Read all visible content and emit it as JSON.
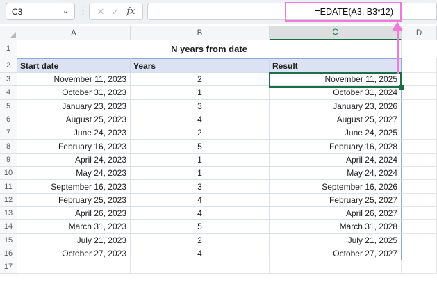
{
  "formula_bar": {
    "name_box_value": "C3",
    "formula": "=EDATE(A3, B3*12)",
    "icons": {
      "chevron_down": "⌄",
      "more_dots": "⋮",
      "cancel": "✕",
      "enter": "✓",
      "insert_function": "fx"
    }
  },
  "colors": {
    "selection_green": "#1a7043",
    "annotation_pink": "#f07ad9",
    "table_header_fill": "#dbe2f3",
    "table_border_blue": "#8ea9db"
  },
  "sheet": {
    "selected_cell": "C3",
    "columns": [
      {
        "letter": "A"
      },
      {
        "letter": "B"
      },
      {
        "letter": "C"
      },
      {
        "letter": "D"
      }
    ],
    "title_row": {
      "n": "1",
      "title": "N years from date"
    },
    "header_row": {
      "n": "2",
      "start": "Start date",
      "years": "Years",
      "result": "Result"
    },
    "rows": [
      {
        "n": "3",
        "start": "November 11, 2023",
        "years": "2",
        "result": "November 11, 2025"
      },
      {
        "n": "4",
        "start": "October 31, 2023",
        "years": "1",
        "result": "October 31, 2024"
      },
      {
        "n": "5",
        "start": "January 23, 2023",
        "years": "3",
        "result": "January 23, 2026"
      },
      {
        "n": "6",
        "start": "August 25, 2023",
        "years": "4",
        "result": "August 25, 2027"
      },
      {
        "n": "7",
        "start": "June 24, 2023",
        "years": "2",
        "result": "June 24, 2025"
      },
      {
        "n": "8",
        "start": "February 16, 2023",
        "years": "5",
        "result": "February 16, 2028"
      },
      {
        "n": "9",
        "start": "April 24, 2023",
        "years": "1",
        "result": "April 24, 2024"
      },
      {
        "n": "10",
        "start": "May 24, 2023",
        "years": "1",
        "result": "May 24, 2024"
      },
      {
        "n": "11",
        "start": "September 16, 2023",
        "years": "3",
        "result": "September 16, 2026"
      },
      {
        "n": "12",
        "start": "February 25, 2023",
        "years": "4",
        "result": "February 25, 2027"
      },
      {
        "n": "13",
        "start": "April 26, 2023",
        "years": "4",
        "result": "April 26, 2027"
      },
      {
        "n": "14",
        "start": "March 31, 2023",
        "years": "5",
        "result": "March 31, 2028"
      },
      {
        "n": "15",
        "start": "July 21, 2023",
        "years": "2",
        "result": "July 21, 2025"
      },
      {
        "n": "16",
        "start": "October 27, 2023",
        "years": "4",
        "result": "October 27, 2027"
      }
    ],
    "empty_row": {
      "n": "17"
    }
  }
}
